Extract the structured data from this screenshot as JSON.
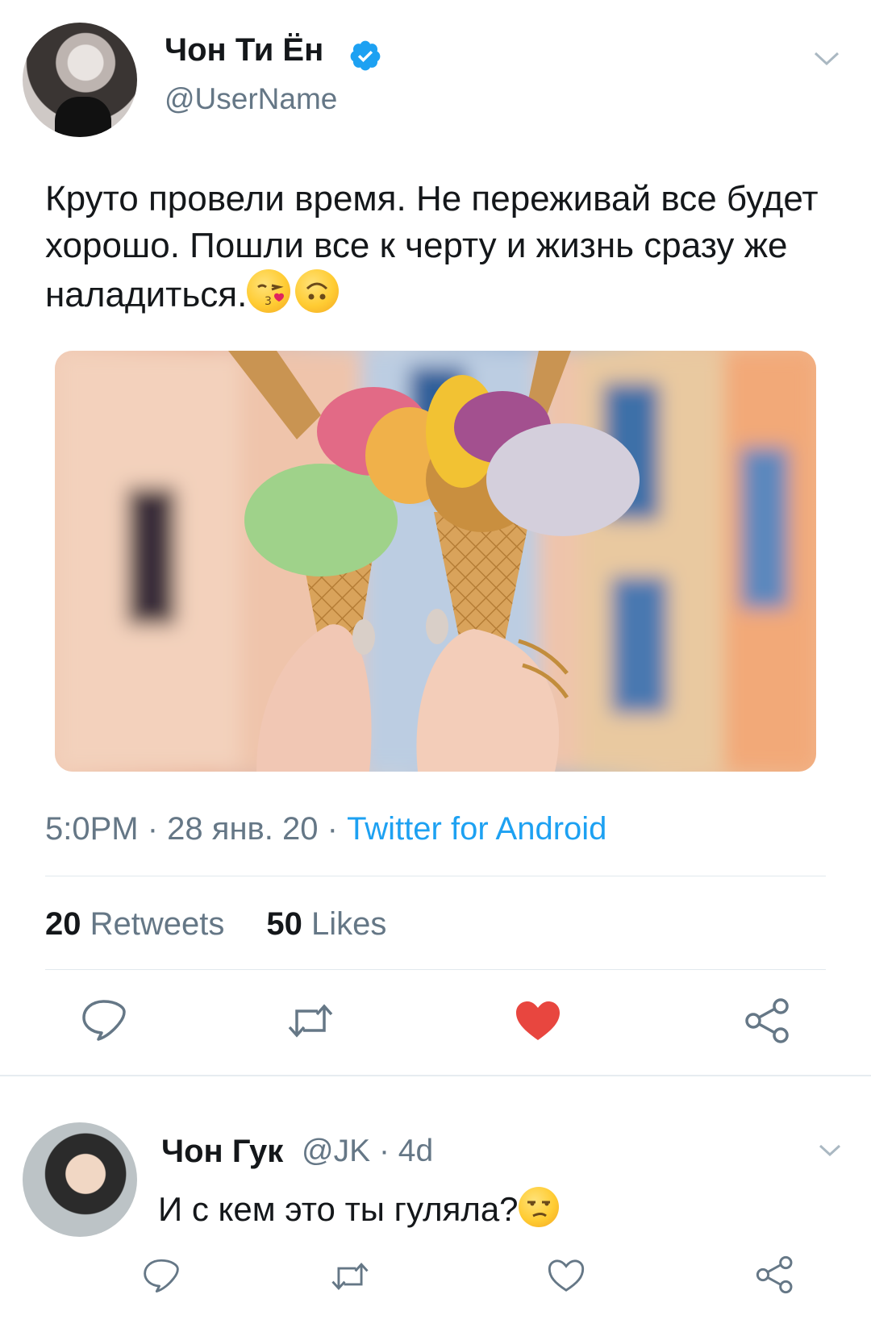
{
  "tweet": {
    "author_name": "Чон Ти Ён",
    "author_handle": "@UserName",
    "text": "Круто провели время. Не переживай все будет хорошо. Пошли все к черту и жизнь сразу же наладиться.",
    "text_emojis": [
      "face-blowing-kiss",
      "upside-down-face"
    ],
    "photo_description": "two ice cream cones",
    "time": "5:0PM",
    "date": "28 янв. 20",
    "source": "Twitter for Android",
    "retweets_count": "20",
    "retweets_label": "Retweets",
    "likes_count": "50",
    "likes_label": "Likes",
    "liked": true
  },
  "reply": {
    "author_name": "Чон Гук",
    "author_handle": "@JK",
    "age": "4d",
    "text": "И с кем это ты гуляла?",
    "text_emoji": "unamused-face",
    "liked": false
  },
  "colors": {
    "text": "#14171a",
    "secondary": "#657786",
    "accent": "#1da1f2",
    "like": "#e0245e",
    "divider": "#e1e8ed"
  }
}
